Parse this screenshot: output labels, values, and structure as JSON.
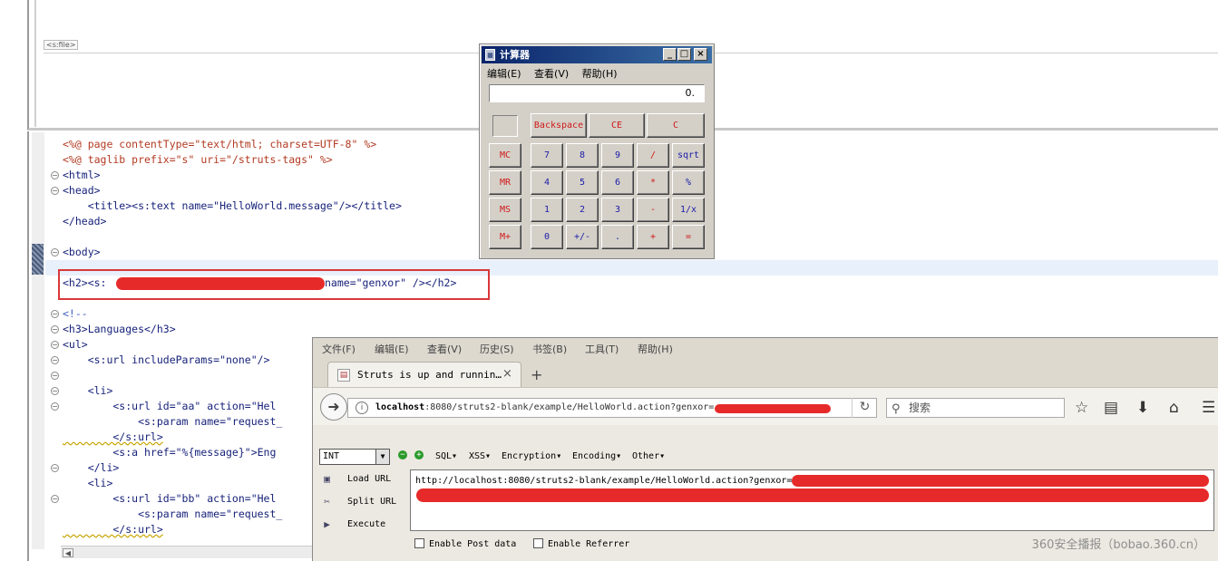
{
  "design_pane": {
    "file_tag": "<s:file>"
  },
  "code": {
    "lines": [
      {
        "t": "jsp",
        "text": "<%@ page contentType=\"text/html; charset=UTF-8\" %>"
      },
      {
        "t": "jsp",
        "text": "<%@ taglib prefix=\"s\" uri=\"/struts-tags\" %>"
      },
      {
        "t": "tag",
        "text": "<html>"
      },
      {
        "t": "tag",
        "text": "<head>"
      },
      {
        "t": "tag",
        "text": "    <title><s:text name=\"HelloWorld.message\"/></title>"
      },
      {
        "t": "tag",
        "text": "</head>"
      },
      {
        "t": "tag",
        "text": "<body>"
      },
      {
        "t": "tag",
        "text": "<h2><s:"
      },
      {
        "t": "tag",
        "text": "name=\"genxor\" /></h2>"
      },
      {
        "t": "cmt",
        "text": "<!--"
      },
      {
        "t": "tag",
        "text": "<h3>Languages</h3>"
      },
      {
        "t": "tag",
        "text": "<ul>"
      },
      {
        "t": "tag",
        "text": "    <s:url includeParams=\"none\"/>"
      },
      {
        "t": "tag",
        "text": "    <li>"
      },
      {
        "t": "tag",
        "text": "        <s:url id=\"aa\" action=\"Hel"
      },
      {
        "t": "tag",
        "text": "            <s:param name=\"request_"
      },
      {
        "t": "tag",
        "text": "        </s:url>"
      },
      {
        "t": "tag",
        "text": "        <s:a href=\"%{message}\">Eng"
      },
      {
        "t": "tag",
        "text": "    </li>"
      },
      {
        "t": "tag",
        "text": "    <li>"
      },
      {
        "t": "tag",
        "text": "        <s:url id=\"bb\" action=\"Hel"
      },
      {
        "t": "tag",
        "text": "            <s:param name=\"request_"
      },
      {
        "t": "tag",
        "text": "        </s:url>"
      }
    ]
  },
  "calculator": {
    "title": "计算器",
    "menu": [
      "编辑(E)",
      "查看(V)",
      "帮助(H)"
    ],
    "display": "0.",
    "window_buttons": [
      "_",
      "□",
      "×"
    ],
    "row_top": [
      "Backspace",
      "CE",
      "C"
    ],
    "memory": [
      "MC",
      "MR",
      "MS",
      "M+"
    ],
    "rows": [
      [
        "7",
        "8",
        "9",
        "/",
        "sqrt"
      ],
      [
        "4",
        "5",
        "6",
        "*",
        "%"
      ],
      [
        "1",
        "2",
        "3",
        "-",
        "1/x"
      ],
      [
        "0",
        "+/-",
        ".",
        "+",
        "="
      ]
    ]
  },
  "browser": {
    "menu": [
      "文件(F)",
      "编辑(E)",
      "查看(V)",
      "历史(S)",
      "书签(B)",
      "工具(T)",
      "帮助(H)"
    ],
    "tab_title": "Struts is up and runnin…",
    "tab_close": "×",
    "new_tab": "+",
    "url_host": "localhost",
    "url_rest": ":8080/struts2-blank/example/HelloWorld.action?genxor=",
    "search_placeholder": "搜索",
    "hackbar": {
      "select_value": "INT",
      "menus": [
        "SQL▾",
        "XSS▾",
        "Encryption▾",
        "Encoding▾",
        "Other▾"
      ],
      "actions": [
        "Load URL",
        "Split URL",
        "Execute"
      ],
      "textarea_value": "http://localhost:8080/struts2-blank/example/HelloWorld.action?genxor=",
      "checkboxes": [
        "Enable Post data",
        "Enable Referrer"
      ]
    }
  },
  "watermark": "360安全播报（bobao.360.cn）",
  "colors": {
    "redaction": "#e62a2a",
    "highlight_box": "#d9383a",
    "calc_blue": "#1a1aa8",
    "calc_red": "#d01818"
  }
}
